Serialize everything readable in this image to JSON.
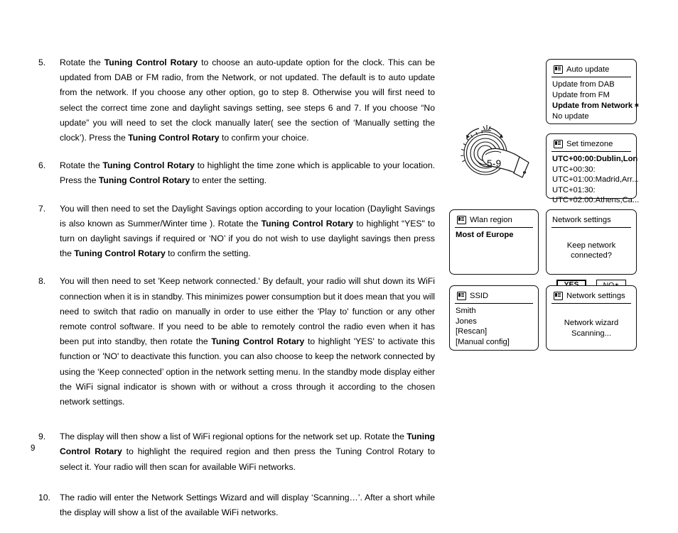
{
  "document": {
    "page_number": "9"
  },
  "steps": [
    {
      "number": "5.",
      "segments": [
        {
          "t": "Rotate the ",
          "b": false
        },
        {
          "t": "Tuning Control Rotary",
          "b": true
        },
        {
          "t": " to choose an auto-update option for the clock. This can be updated from DAB or FM radio, from the Network, or not updated. The default is to auto update from the network. If you choose any other option, go to step 8. Otherwise you will first need to select the correct time zone and daylight savings setting, see steps 6 and 7. If you choose “No update” you will need to set the clock manually later( see the section of ‘Manually setting the clock’). Press the ",
          "b": false
        },
        {
          "t": "Tuning Control Rotary",
          "b": true
        },
        {
          "t": " to confirm your choice.",
          "b": false
        }
      ]
    },
    {
      "number": "6.",
      "segments": [
        {
          "t": "Rotate the ",
          "b": false
        },
        {
          "t": "Tuning Control Rotary",
          "b": true
        },
        {
          "t": " to highlight the time zone which is applicable to your location. Press the ",
          "b": false
        },
        {
          "t": "Tuning Control Rotary",
          "b": true
        },
        {
          "t": " to enter the setting.",
          "b": false
        }
      ]
    },
    {
      "number": "7.",
      "segments": [
        {
          "t": "You will then need to set the Daylight Savings option according to your location (Daylight Savings is also known as Summer/Winter time ). Rotate the ",
          "b": false
        },
        {
          "t": "Tuning Control Rotary",
          "b": true
        },
        {
          "t": " to highlight “YES\" to turn on daylight savings if required or ‘NO’ if you do not wish to use daylight savings then press the ",
          "b": false
        },
        {
          "t": "Tuning Control Rotary",
          "b": true
        },
        {
          "t": " to confirm the setting.",
          "b": false
        }
      ]
    },
    {
      "number": "8.",
      "segments": [
        {
          "t": "You will then need to set 'Keep network connected.' By default, your radio will shut down its WiFi connection when it is in standby. This minimizes power consumption but it does mean that you will need to switch that radio on manually in order to use either the 'Play to' function or any other remote control software. If you need to be able to remotely control the radio even when it has been put into standby, then rotate the ",
          "b": false
        },
        {
          "t": "Tuning Control Rotary",
          "b": true
        },
        {
          "t": " to highlight 'YES' to activate this function or 'NO' to deactivate this function. you can also choose to keep the network connected by using the ‘Keep connected’ option in the network setting menu. In the standby mode display either the WiFi signal indicator is shown with or without a cross through it according to the chosen network settings.",
          "b": false
        }
      ]
    },
    {
      "number": "9.",
      "segments": [
        {
          "t": "The display will then show a list of WiFi regional options for the network set up. Rotate the ",
          "b": false
        },
        {
          "t": "Tuning Control Rotary",
          "b": true
        },
        {
          "t": " to highlight the required region and then press the Tuning Control Rotary to select it. Your radio will then scan for available WiFi networks.",
          "b": false
        }
      ]
    },
    {
      "number": "10.",
      "segments": [
        {
          "t": "The radio will enter the Network Settings Wizard and will display ‘Scanning…’. After a short while the display will show a list of the available WiFi networks.",
          "b": false
        }
      ]
    }
  ],
  "illustration": {
    "label": "5-9",
    "icon": "hand-turning-rotary-knob"
  },
  "panels": {
    "auto_update": {
      "title": "Auto update",
      "has_icon": true,
      "items": [
        {
          "label": "Update from DAB",
          "selected": false,
          "star": false
        },
        {
          "label": "Update from FM",
          "selected": false,
          "star": false
        },
        {
          "label": "Update from Network",
          "selected": true,
          "star": true
        },
        {
          "label": "No update",
          "selected": false,
          "star": false
        }
      ]
    },
    "set_timezone": {
      "title": "Set timezone",
      "has_icon": true,
      "items": [
        {
          "label": "UTC+00:00:Dublin,Lon",
          "selected": true,
          "star": false
        },
        {
          "label": "UTC+00:30:",
          "selected": false,
          "star": false
        },
        {
          "label": "UTC+01:00:Madrid,Arr...",
          "selected": false,
          "star": false
        },
        {
          "label": "UTC+01:30:",
          "selected": false,
          "star": false
        },
        {
          "label": "UTC+02:00:Athens,Ca...",
          "selected": false,
          "star": false
        }
      ]
    },
    "wlan_region": {
      "title": "Wlan region",
      "has_icon": true,
      "items": [
        {
          "label": "Most of Europe",
          "selected": true,
          "star": false
        }
      ]
    },
    "keep_network": {
      "title": "Network settings",
      "has_icon": false,
      "prompt": "Keep network connected?",
      "yes_label": "YES",
      "no_label": "NO",
      "no_star": "∗"
    },
    "ssid": {
      "title": "SSID",
      "has_icon": true,
      "items": [
        {
          "label": "Smith",
          "selected": false,
          "star": false
        },
        {
          "label": "Jones",
          "selected": false,
          "star": false
        },
        {
          "label": "[Rescan]",
          "selected": false,
          "star": false
        },
        {
          "label": "[Manual config]",
          "selected": false,
          "star": false
        }
      ]
    },
    "network_settings": {
      "title": "Network settings",
      "has_icon": true,
      "lines": [
        "Network wizard",
        "Scanning..."
      ]
    }
  }
}
